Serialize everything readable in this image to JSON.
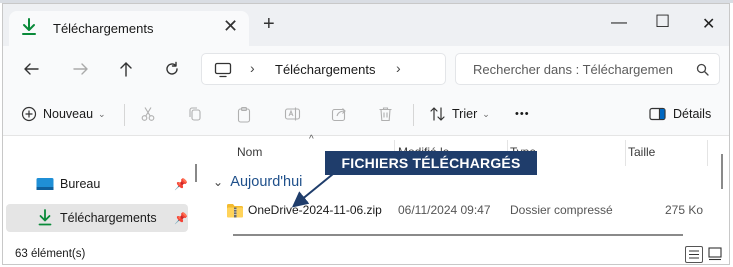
{
  "tab": {
    "title": "Téléchargements",
    "close": "✕",
    "new_tab": "+"
  },
  "window_controls": {
    "minimize": "—",
    "maximize": "☐",
    "close": "✕"
  },
  "nav": {
    "back": "back-arrow-icon",
    "forward": "forward-arrow-icon",
    "up": "up-arrow-icon",
    "refresh": "refresh-icon"
  },
  "address": {
    "separator": "›",
    "crumb": "Téléchargements"
  },
  "search": {
    "placeholder": "Rechercher dans : Téléchargemen"
  },
  "commands": {
    "new_label": "Nouveau",
    "sort_label": "Trier",
    "more_label": "•••",
    "details_label": "Détails"
  },
  "sidebar": {
    "items": [
      {
        "label": "Bureau",
        "icon": "desktop-folder-icon",
        "pinned": true
      },
      {
        "label": "Téléchargements",
        "icon": "download-icon",
        "pinned": true,
        "selected": true
      }
    ]
  },
  "table": {
    "columns": [
      "Nom",
      "Modifié le",
      "Type",
      "Taille"
    ],
    "group_label": "Aujourd'hui",
    "rows": [
      {
        "name": "OneDrive-2024-11-06.zip",
        "modified": "06/11/2024 09:47",
        "type": "Dossier compressé",
        "size": "275 Ko"
      }
    ]
  },
  "annotation": {
    "text": "FICHIERS TÉLÉCHARGÉS",
    "color": "#1f3d6b"
  },
  "status": {
    "item_count": "63 élément(s)"
  },
  "colors": {
    "accent": "#0067c0",
    "titlebar_bg": "#eef0f3",
    "selected_bg": "#e5e5e5"
  }
}
